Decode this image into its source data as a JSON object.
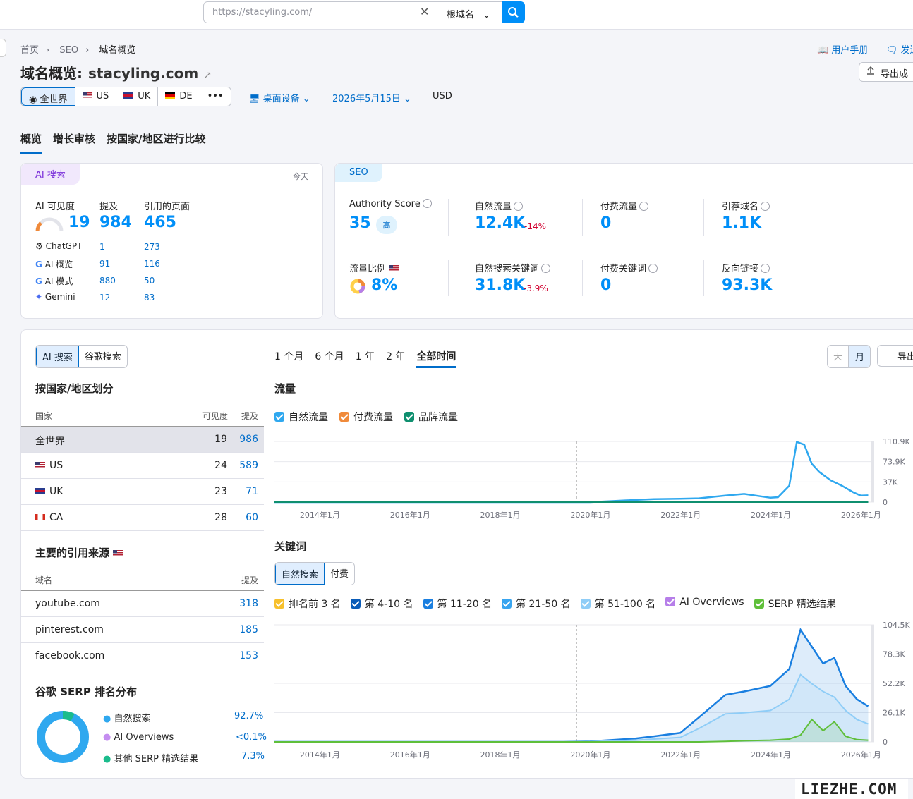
{
  "search": {
    "placeholder": "https://stacyling.com/",
    "scope": "根域名"
  },
  "breadcrumb": [
    "首页",
    "SEO",
    "域名概览"
  ],
  "header": {
    "manual": "用户手册",
    "send": "发送",
    "export": "导出成",
    "title": "域名概览:",
    "domain": "stacyling.com"
  },
  "regions": [
    {
      "label": "全世界"
    },
    {
      "label": "US"
    },
    {
      "label": "UK"
    },
    {
      "label": "DE"
    },
    {
      "label": "•••"
    }
  ],
  "filters": {
    "device": "桌面设备",
    "date": "2026年5月15日",
    "currency": "USD"
  },
  "tabs": [
    "概览",
    "增长审核",
    "按国家/地区进行比较"
  ],
  "ai_card": {
    "tag": "AI 搜索",
    "today": "今天",
    "headers": [
      "AI 可见度",
      "提及",
      "引用的页面"
    ],
    "visibility": "19",
    "mentions": "984",
    "pages": "465",
    "rows": [
      {
        "name": "ChatGPT",
        "mentions": "1",
        "pages": "273"
      },
      {
        "name": "AI 概览",
        "mentions": "91",
        "pages": "116"
      },
      {
        "name": "AI 模式",
        "mentions": "880",
        "pages": "50"
      },
      {
        "name": "Gemini",
        "mentions": "12",
        "pages": "83"
      }
    ]
  },
  "seo_card": {
    "tag": "SEO",
    "metrics": [
      {
        "label": "Authority Score",
        "value": "35",
        "badge": "高"
      },
      {
        "label": "自然流量",
        "value": "12.4K",
        "delta": "-14%"
      },
      {
        "label": "付费流量",
        "value": "0"
      },
      {
        "label": "引荐域名",
        "value": "1.1K"
      },
      {
        "label": "流量比例",
        "value": "8%"
      },
      {
        "label": "自然搜索关键词",
        "value": "31.8K",
        "delta": "-3.9%"
      },
      {
        "label": "付费关键词",
        "value": "0"
      },
      {
        "label": "反向链接",
        "value": "93.3K"
      }
    ]
  },
  "main": {
    "toggle": [
      "AI 搜索",
      "谷歌搜索"
    ],
    "ranges": [
      "1 个月",
      "6 个月",
      "1 年",
      "2 年",
      "全部时间"
    ],
    "daymonth": [
      "天",
      "月"
    ],
    "export": "导出",
    "country_title": "按国家/地区划分",
    "country_head": [
      "国家",
      "可见度",
      "提及"
    ],
    "countries": [
      {
        "name": "全世界",
        "vis": "19",
        "mentions": "986"
      },
      {
        "name": "US",
        "vis": "24",
        "mentions": "589"
      },
      {
        "name": "UK",
        "vis": "23",
        "mentions": "71"
      },
      {
        "name": "CA",
        "vis": "28",
        "mentions": "60"
      }
    ],
    "sources_title": "主要的引用来源",
    "sources_head": [
      "域名",
      "提及"
    ],
    "sources": [
      {
        "domain": "youtube.com",
        "count": "318"
      },
      {
        "domain": "pinterest.com",
        "count": "185"
      },
      {
        "domain": "facebook.com",
        "count": "153"
      }
    ],
    "serp_title": "谷歌 SERP 排名分布",
    "serp": [
      {
        "label": "自然搜索",
        "value": "92.7%",
        "color": "#2fa8ef"
      },
      {
        "label": "AI Overviews",
        "value": "<0.1%",
        "color": "#c48df0"
      },
      {
        "label": "其他 SERP 精选结果",
        "value": "7.3%",
        "color": "#1bbc8c"
      }
    ],
    "traffic_title": "流量",
    "traffic_legend": [
      {
        "label": "自然流量",
        "color": "#2fa8ef"
      },
      {
        "label": "付费流量",
        "color": "#f08a3a"
      },
      {
        "label": "品牌流量",
        "color": "#0f8f6f"
      }
    ],
    "keywords_title": "关键词",
    "kw_toggle": [
      "自然搜索",
      "付费"
    ],
    "kw_legend": [
      {
        "label": "排名前 3 名",
        "color": "#f7c02c"
      },
      {
        "label": "第 4-10 名",
        "color": "#0a5cb8"
      },
      {
        "label": "第 11-20 名",
        "color": "#1a7fe0"
      },
      {
        "label": "第 21-50 名",
        "color": "#38a5f0"
      },
      {
        "label": "第 51-100 名",
        "color": "#8fcdf7"
      },
      {
        "label": "AI Overviews",
        "color": "#b67ee9"
      },
      {
        "label": "SERP 精选结果",
        "color": "#5fbf3a"
      }
    ],
    "x_ticks": [
      "2014年1月",
      "2016年1月",
      "2018年1月",
      "2020年1月",
      "2022年1月",
      "2024年1月",
      "2026年1月"
    ],
    "traffic_y": [
      "110.9K",
      "73.9K",
      "37K",
      "0"
    ],
    "kw_y": [
      "104.5K",
      "78.3K",
      "52.2K",
      "26.1K",
      "0"
    ]
  },
  "chart_data": [
    {
      "type": "line",
      "title": "流量",
      "x": [
        "2013-01",
        "2014-01",
        "2015-01",
        "2016-01",
        "2017-01",
        "2018-01",
        "2019-01",
        "2019-06",
        "2020-01",
        "2020-06",
        "2021-01",
        "2021-06",
        "2022-01",
        "2022-06",
        "2023-01",
        "2023-06",
        "2024-01",
        "2024-03",
        "2024-06",
        "2024-08",
        "2024-10",
        "2024-12",
        "2025-02",
        "2025-05",
        "2025-08",
        "2025-11",
        "2026-01",
        "2026-03"
      ],
      "series": [
        {
          "name": "自然流量",
          "values": [
            0,
            0,
            0,
            0,
            0,
            0,
            0,
            0,
            0,
            1500,
            4000,
            5500,
            6000,
            7000,
            12000,
            15000,
            8000,
            9000,
            30000,
            110000,
            105000,
            70000,
            55000,
            40000,
            30000,
            18000,
            12000,
            12400
          ]
        },
        {
          "name": "付费流量",
          "values": [
            0,
            0,
            0,
            0,
            0,
            0,
            0,
            0,
            0,
            0,
            0,
            0,
            0,
            0,
            0,
            0,
            0,
            0,
            0,
            0,
            0,
            0,
            0,
            0,
            0,
            0,
            0,
            0
          ]
        },
        {
          "name": "品牌流量",
          "values": [
            0,
            0,
            0,
            0,
            0,
            0,
            0,
            0,
            0,
            0,
            0,
            0,
            0,
            0,
            0,
            0,
            0,
            0,
            0,
            0,
            0,
            0,
            0,
            0,
            0,
            0,
            0,
            0
          ]
        }
      ],
      "ylim": [
        0,
        110900
      ]
    },
    {
      "type": "area",
      "title": "关键词",
      "x": [
        "2013-01",
        "2015-01",
        "2017-01",
        "2019-01",
        "2019-06",
        "2020-01",
        "2021-01",
        "2021-06",
        "2022-01",
        "2022-06",
        "2023-01",
        "2023-06",
        "2024-01",
        "2024-06",
        "2024-09",
        "2024-12",
        "2025-03",
        "2025-06",
        "2025-09",
        "2025-12",
        "2026-03"
      ],
      "series": [
        {
          "name": "排名前 3 名",
          "values": [
            0,
            0,
            0,
            0,
            0,
            500,
            3000,
            5000,
            8000,
            22000,
            42000,
            45000,
            50000,
            65000,
            100000,
            85000,
            70000,
            75000,
            50000,
            38000,
            31800
          ]
        },
        {
          "name": "第 51-100 名",
          "values": [
            0,
            0,
            0,
            0,
            0,
            300,
            1500,
            2500,
            4000,
            12000,
            25000,
            26000,
            28000,
            38000,
            60000,
            52000,
            45000,
            40000,
            28000,
            20000,
            16000
          ]
        },
        {
          "name": "SERP 精选结果",
          "values": [
            0,
            0,
            0,
            0,
            0,
            0,
            0,
            0,
            0,
            0,
            500,
            1000,
            1500,
            2500,
            6000,
            20000,
            10000,
            18000,
            5000,
            2000,
            1500
          ]
        }
      ],
      "ylim": [
        0,
        104500
      ]
    }
  ]
}
